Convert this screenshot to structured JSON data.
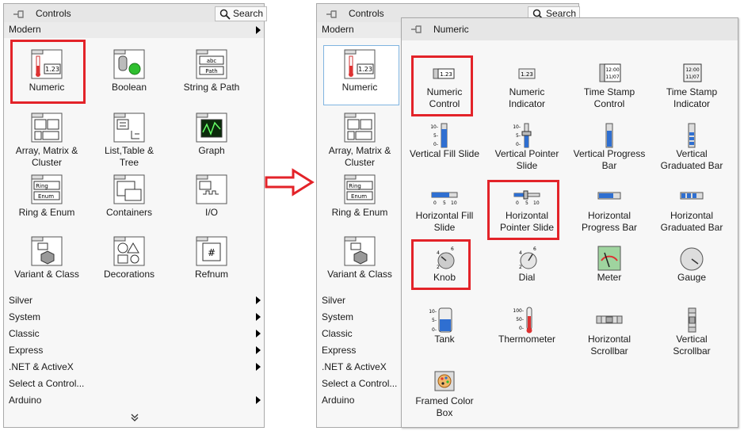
{
  "left_panel": {
    "title": "Controls",
    "search_label": "Search",
    "section": "Modern",
    "tiles": [
      {
        "label": "Numeric"
      },
      {
        "label": "Boolean"
      },
      {
        "label": "String & Path"
      },
      {
        "label": "Array, Matrix &\nCluster"
      },
      {
        "label": "List,Table &\nTree"
      },
      {
        "label": "Graph"
      },
      {
        "label": "Ring & Enum"
      },
      {
        "label": "Containers"
      },
      {
        "label": "I/O"
      },
      {
        "label": "Variant & Class"
      },
      {
        "label": "Decorations"
      },
      {
        "label": "Refnum"
      }
    ],
    "categories": [
      "Silver",
      "System",
      "Classic",
      "Express",
      ".NET & ActiveX",
      "Select a Control...",
      "Arduino"
    ]
  },
  "right_panel": {
    "title": "Controls",
    "search_label": "Search",
    "section": "Modern",
    "tiles": [
      {
        "label": "Numeric"
      },
      {
        "label": "Array, Matrix &\nCluster"
      },
      {
        "label": "Ring & Enum"
      },
      {
        "label": "Variant & Class"
      }
    ],
    "categories": [
      "Silver",
      "System",
      "Classic",
      "Express",
      ".NET & ActiveX",
      "Select a Control...",
      "Arduino"
    ]
  },
  "numeric_palette": {
    "title": "Numeric",
    "items": [
      {
        "label": "Numeric\nControl"
      },
      {
        "label": "Numeric\nIndicator"
      },
      {
        "label": "Time Stamp\nControl"
      },
      {
        "label": "Time Stamp\nIndicator"
      },
      {
        "label": "Vertical Fill Slide"
      },
      {
        "label": "Vertical Pointer\nSlide"
      },
      {
        "label": "Vertical Progress\nBar"
      },
      {
        "label": "Vertical\nGraduated Bar"
      },
      {
        "label": "Horizontal Fill\nSlide"
      },
      {
        "label": "Horizontal\nPointer Slide"
      },
      {
        "label": "Horizontal\nProgress Bar"
      },
      {
        "label": "Horizontal\nGraduated Bar"
      },
      {
        "label": "Knob"
      },
      {
        "label": "Dial"
      },
      {
        "label": "Meter"
      },
      {
        "label": "Gauge"
      },
      {
        "label": "Tank"
      },
      {
        "label": "Thermometer"
      },
      {
        "label": "Horizontal\nScrollbar"
      },
      {
        "label": "Vertical\nScrollbar"
      },
      {
        "label": "Framed Color\nBox"
      }
    ]
  },
  "colors": {
    "highlight": "#e32329",
    "arrow": "#e32329",
    "panel_bg": "#f7f7f7",
    "header_bg": "#e6e6e6"
  }
}
